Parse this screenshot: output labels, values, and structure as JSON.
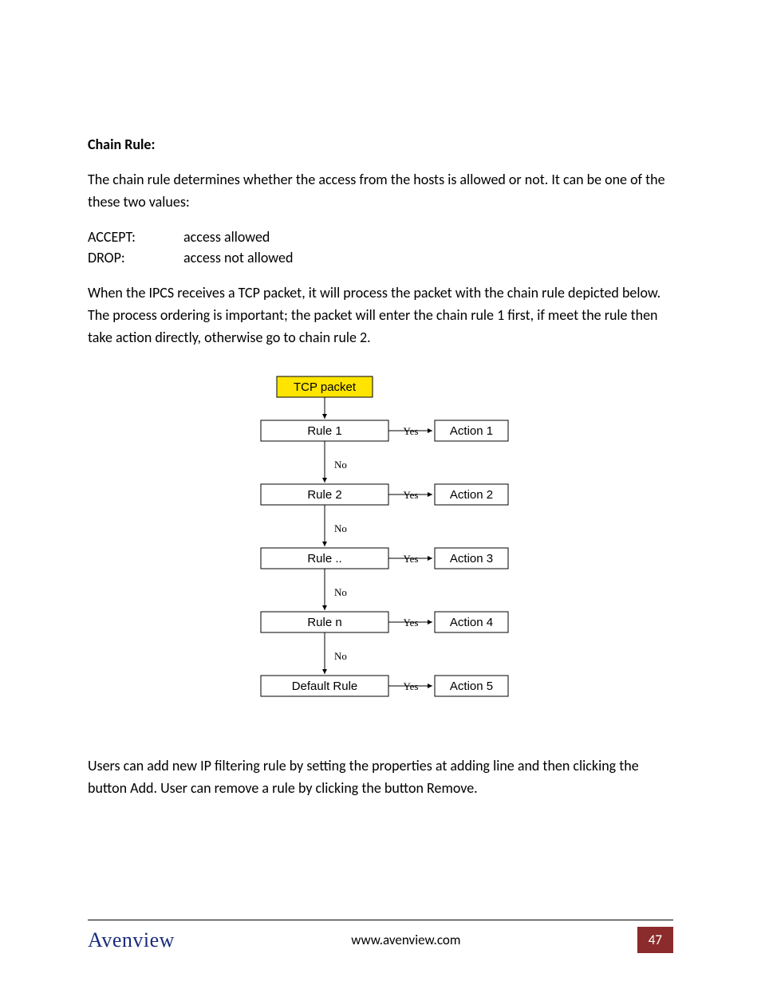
{
  "heading": "Chain Rule:",
  "para1": "The chain rule determines whether the access from the hosts is allowed or not. It can be one of the these two values:",
  "defs": [
    {
      "term": "ACCEPT:",
      "desc": "access allowed"
    },
    {
      "term": "DROP:",
      "desc": "access not allowed"
    }
  ],
  "para2": "When the IPCS receives a TCP packet, it will process the packet with the chain rule depicted below. The process ordering is important; the packet will enter the chain rule 1 first, if meet the rule then take action directly, otherwise go to chain rule 2.",
  "diagram": {
    "start": "TCP packet",
    "yes": "Yes",
    "no": "No",
    "steps": [
      {
        "rule": "Rule 1",
        "action": "Action 1"
      },
      {
        "rule": "Rule 2",
        "action": "Action 2"
      },
      {
        "rule": "Rule ..",
        "action": "Action 3"
      },
      {
        "rule": "Rule n",
        "action": "Action 4"
      },
      {
        "rule": "Default Rule",
        "action": "Action 5"
      }
    ]
  },
  "para3": "Users can add new IP filtering rule by setting the properties at adding line and then clicking the button Add. User can remove a rule by clicking the button Remove.",
  "footer": {
    "brand": "Avenview",
    "url": "www.avenview.com",
    "page": "47"
  }
}
